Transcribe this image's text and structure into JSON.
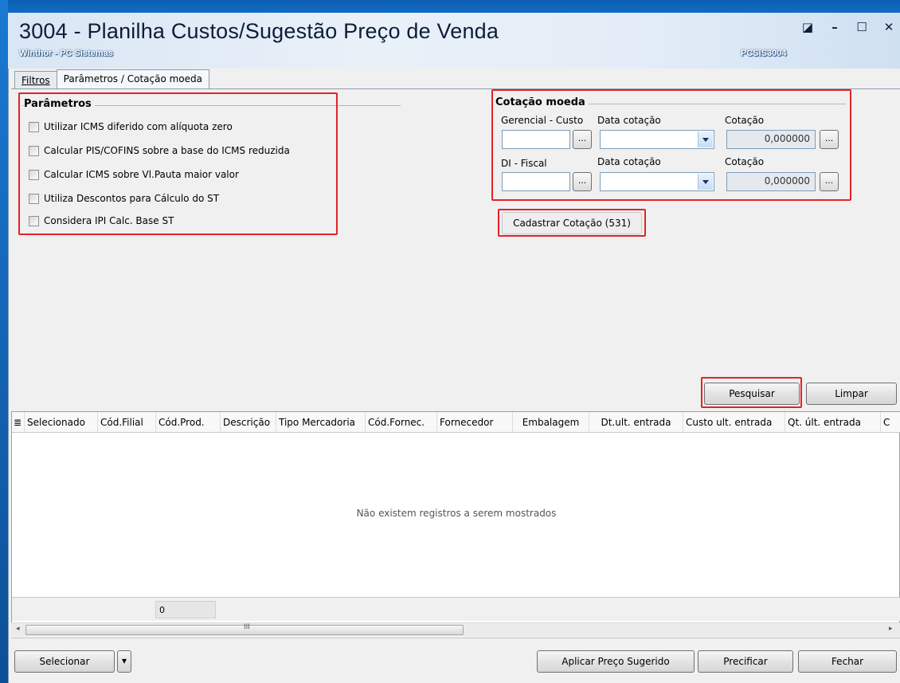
{
  "window": {
    "title": "3004 - Planilha Custos/Sugestão Preço de Venda",
    "subtitle": "Winthor - PC Sistemas",
    "code": "PCSIS3004",
    "buttons": {
      "restore": "◪",
      "minimize": "–",
      "maximize": "☐",
      "close": "✕"
    }
  },
  "tabs": [
    {
      "label": "Filtros",
      "active": false
    },
    {
      "label": "Parâmetros / Cotação moeda",
      "active": true
    }
  ],
  "parametros": {
    "title": "Parâmetros",
    "options": [
      {
        "label": "Utilizar ICMS diferido com alíquota zero",
        "checked": false
      },
      {
        "label": "Calcular PIS/COFINS sobre a base do ICMS reduzida",
        "checked": false
      },
      {
        "label": "Calcular ICMS sobre Vl.Pauta maior valor",
        "checked": false
      },
      {
        "label": "Utiliza Descontos para Cálculo do ST",
        "checked": false
      },
      {
        "label": "Considera IPI Calc. Base ST",
        "checked": false
      }
    ]
  },
  "cotacao": {
    "title": "Cotação moeda",
    "gerencial_label": "Gerencial - Custo",
    "data_cotacao_label": "Data cotação",
    "cotacao_label": "Cotação",
    "gerencial_value": "",
    "gerencial_date": "",
    "gerencial_cotacao": "0,000000",
    "fiscal_label": "DI - Fiscal",
    "fiscal_data_cotacao_label": "Data cotação",
    "fiscal_cotacao_label": "Cotação",
    "fiscal_value": "",
    "fiscal_date": "",
    "fiscal_cotacao": "0,000000",
    "ellipsis": "...",
    "cadastrar_label": "Cadastrar Cotação (531)"
  },
  "actions": {
    "pesquisar": "Pesquisar",
    "limpar": "Limpar"
  },
  "grid": {
    "menu_icon": "≣",
    "columns": [
      "Selecionado",
      "Cód.Filial",
      "Cód.Prod.",
      "Descrição",
      "Tipo Mercadoria",
      "Cód.Fornec.",
      "Fornecedor",
      "Embalagem",
      "Dt.ult. entrada",
      "Custo ult. entrada",
      "Qt. últ. entrada",
      "C"
    ],
    "empty_message": "Não existem registros a serem mostrados",
    "summary_value": "0",
    "scroll_grip": "III",
    "scroll_left": "◂",
    "scroll_right": "▸"
  },
  "footer": {
    "selecionar": "Selecionar",
    "dropdown": "▾",
    "aplicar": "Aplicar Preço Sugerido",
    "precificar": "Precificar",
    "fechar": "Fechar"
  },
  "colors": {
    "highlight": "#e3222a",
    "title_bar": "#1a79d2"
  }
}
